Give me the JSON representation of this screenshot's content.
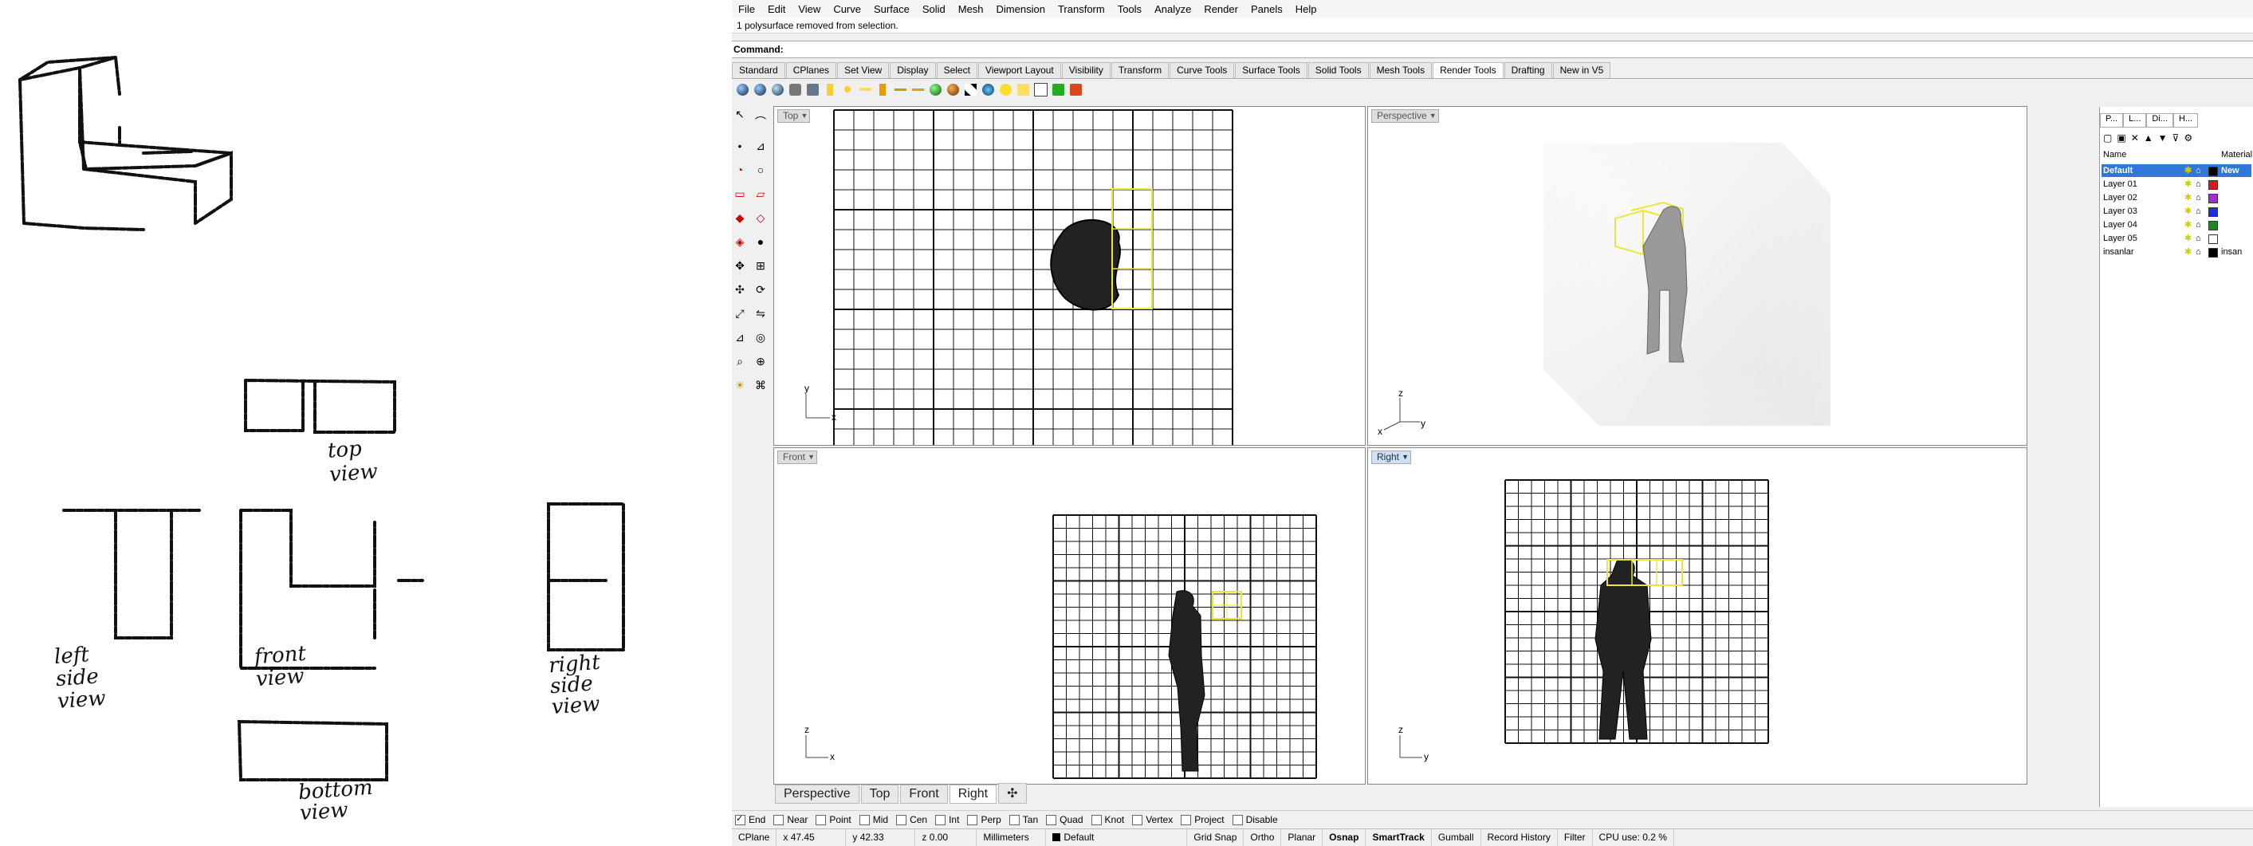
{
  "sketch": {
    "labels": [
      "top\nview",
      "left\nside\nview",
      "front\nview",
      "right\nside\nview",
      "bottom\nview"
    ]
  },
  "menu": [
    "File",
    "Edit",
    "View",
    "Curve",
    "Surface",
    "Solid",
    "Mesh",
    "Dimension",
    "Transform",
    "Tools",
    "Analyze",
    "Render",
    "Panels",
    "Help"
  ],
  "history_text": "1 polysurface removed from selection.",
  "command": {
    "label": "Command:",
    "value": ""
  },
  "toolbar_tabs": [
    "Standard",
    "CPlanes",
    "Set View",
    "Display",
    "Select",
    "Viewport Layout",
    "Visibility",
    "Transform",
    "Curve Tools",
    "Surface Tools",
    "Solid Tools",
    "Mesh Tools",
    "Render Tools",
    "Drafting",
    "New in V5"
  ],
  "active_toolbar_tab": "Render Tools",
  "viewports": {
    "top": {
      "label": "Top",
      "axis1": "y",
      "axis2": "x"
    },
    "perspective": {
      "label": "Perspective",
      "axis1": "z",
      "axis2": "x",
      "axis3": "y"
    },
    "front": {
      "label": "Front",
      "axis1": "z",
      "axis2": "x"
    },
    "right": {
      "label": "Right",
      "axis1": "z",
      "axis2": "y"
    }
  },
  "viewport_tabs": [
    "Perspective",
    "Top",
    "Front",
    "Right"
  ],
  "active_viewport_tab": "Right",
  "osnaps": [
    {
      "label": "End",
      "on": true
    },
    {
      "label": "Near",
      "on": false
    },
    {
      "label": "Point",
      "on": false
    },
    {
      "label": "Mid",
      "on": false
    },
    {
      "label": "Cen",
      "on": false
    },
    {
      "label": "Int",
      "on": false
    },
    {
      "label": "Perp",
      "on": false
    },
    {
      "label": "Tan",
      "on": false
    },
    {
      "label": "Quad",
      "on": false
    },
    {
      "label": "Knot",
      "on": false
    },
    {
      "label": "Vertex",
      "on": false
    },
    {
      "label": "Project",
      "on": false
    },
    {
      "label": "Disable",
      "on": false
    }
  ],
  "status": {
    "cplane": "CPlane",
    "x": "x 47.45",
    "y": "y 42.33",
    "z": "z 0.00",
    "units": "Millimeters",
    "layer": "Default",
    "grid_snap": "Grid Snap",
    "ortho": "Ortho",
    "planar": "Planar",
    "osnap": "Osnap",
    "smarttrack": "SmartTrack",
    "gumball": "Gumball",
    "record_history": "Record History",
    "filter": "Filter",
    "cpu": "CPU use: 0.2 %"
  },
  "layers_panel": {
    "tabs": [
      "P...",
      "L...",
      "Di...",
      "H..."
    ],
    "col_name": "Name",
    "col_material": "Material",
    "layers": [
      {
        "name": "Default",
        "color": "#000000",
        "selected": true,
        "material": "New"
      },
      {
        "name": "Layer 01",
        "color": "#d81c1c",
        "selected": false,
        "material": ""
      },
      {
        "name": "Layer 02",
        "color": "#9b2fd0",
        "selected": false,
        "material": ""
      },
      {
        "name": "Layer 03",
        "color": "#1a2fd8",
        "selected": false,
        "material": ""
      },
      {
        "name": "Layer 04",
        "color": "#1e8a1e",
        "selected": false,
        "material": ""
      },
      {
        "name": "Layer 05",
        "color": "#ffffff",
        "selected": false,
        "material": ""
      },
      {
        "name": "insanlar",
        "color": "#000000",
        "selected": false,
        "material": "insan"
      }
    ]
  }
}
